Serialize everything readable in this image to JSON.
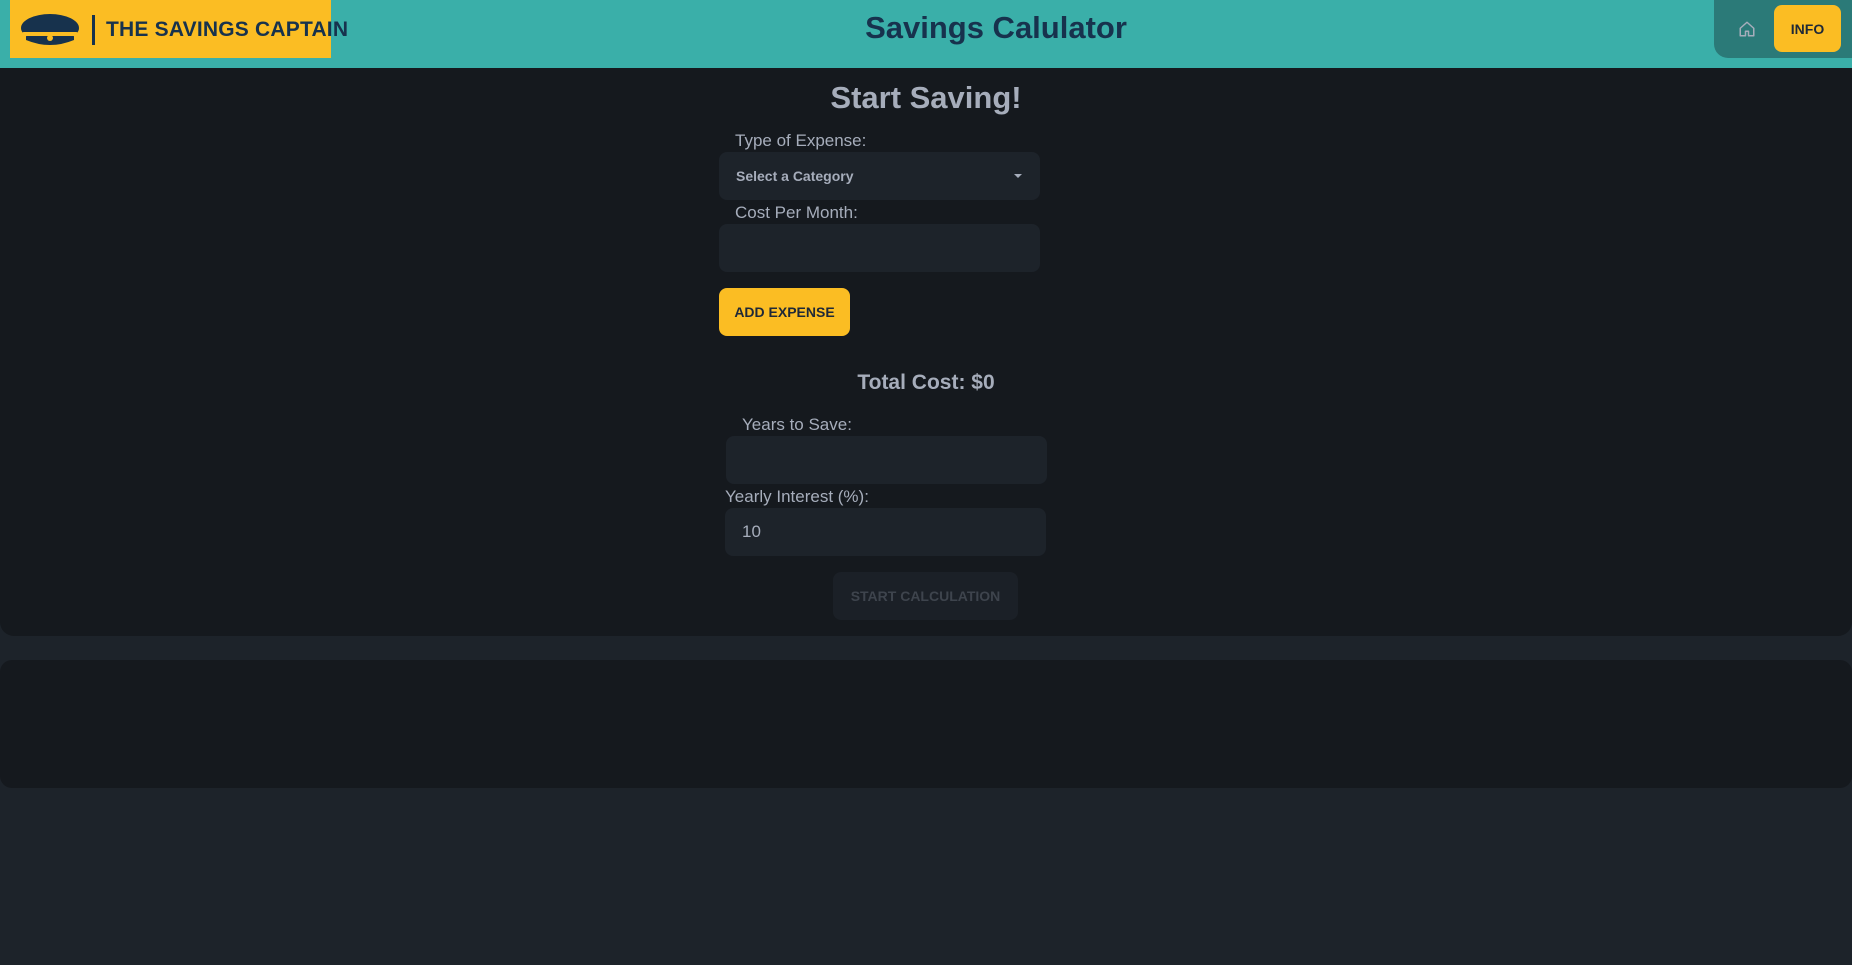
{
  "header": {
    "logo_text": "THE SAVINGS CAPTAIN",
    "title": "Savings Calulator",
    "home_icon": "home-icon",
    "info_label": "INFO"
  },
  "form": {
    "heading": "Start Saving!",
    "expense_type_label": "Type of Expense:",
    "expense_type_value": "Select a Category",
    "cost_label": "Cost Per Month:",
    "cost_value": "",
    "add_button_label": "ADD EXPENSE",
    "total_cost": "Total Cost: $0",
    "years_label": "Years to Save:",
    "years_value": "",
    "interest_label": "Yearly Interest (%):",
    "interest_value": "10",
    "calc_button_label": "START CALCULATION"
  },
  "colors": {
    "accent": "#fbbd23",
    "header_bg": "#3aafa9",
    "nav_bg": "#2b7a78",
    "card_bg": "#15191e",
    "page_bg": "#1d232a",
    "brand_text": "#17324d"
  }
}
